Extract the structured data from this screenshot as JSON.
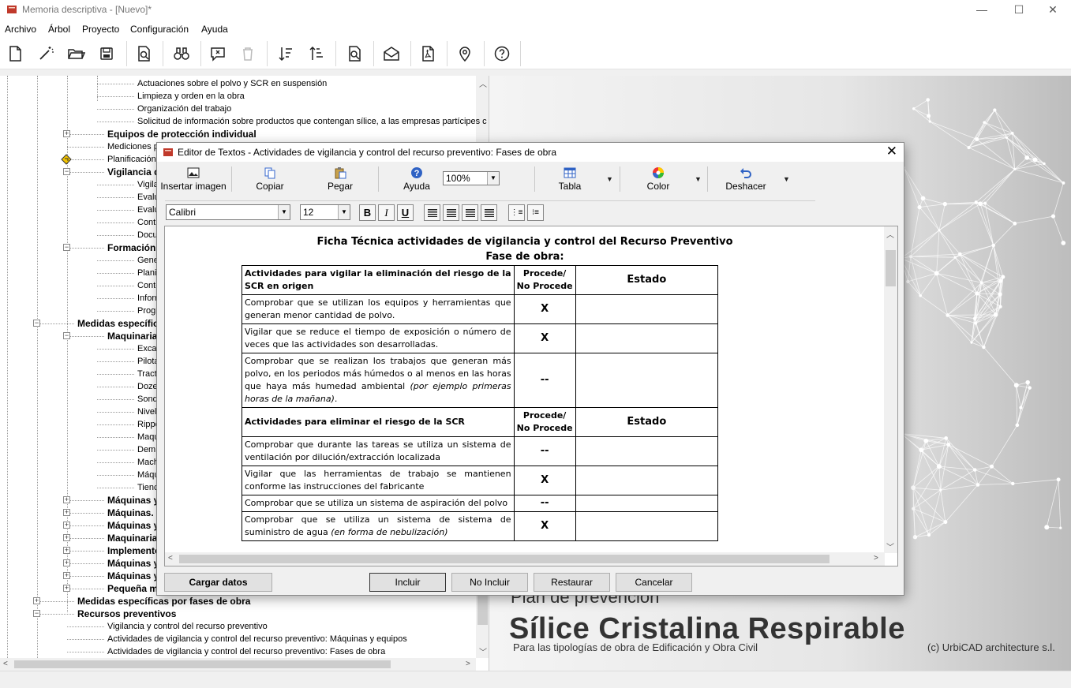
{
  "window": {
    "title": "Memoria descriptiva - [Nuevo]*",
    "minimize": "—",
    "maximize": "☐",
    "close": "✕"
  },
  "menu": [
    "Archivo",
    "Árbol",
    "Proyecto",
    "Configuración",
    "Ayuda"
  ],
  "tree": {
    "rows": [
      {
        "label": "Actuaciones sobre el polvo y SCR en suspensión",
        "bold": false
      },
      {
        "label": "Limpieza y orden en la obra",
        "bold": false
      },
      {
        "label": "Organización del trabajo",
        "bold": false
      },
      {
        "label": "Solicitud de información sobre productos que contengan sílice, a las empresas partícipes c",
        "bold": false
      },
      {
        "label": "Equipos de protección individual",
        "bold": true
      },
      {
        "label": "Mediciones p",
        "bold": false
      },
      {
        "label": "Planificación",
        "bold": false
      },
      {
        "label": "Vigilancia d",
        "bold": true
      },
      {
        "label": "Vigila",
        "bold": false
      },
      {
        "label": "Evalu",
        "bold": false
      },
      {
        "label": "Evalu",
        "bold": false
      },
      {
        "label": "Contr",
        "bold": false
      },
      {
        "label": "Docu",
        "bold": false
      },
      {
        "label": "Formación",
        "bold": true
      },
      {
        "label": "Gene",
        "bold": false
      },
      {
        "label": "Planif",
        "bold": false
      },
      {
        "label": "Conte",
        "bold": false
      },
      {
        "label": "Inforr",
        "bold": false
      },
      {
        "label": "Progr",
        "bold": false
      },
      {
        "label": "Medidas específic",
        "bold": true
      },
      {
        "label": "Maquinaria",
        "bold": true
      },
      {
        "label": "Exca",
        "bold": false
      },
      {
        "label": "Pilota",
        "bold": false
      },
      {
        "label": "Tract",
        "bold": false
      },
      {
        "label": "Doze",
        "bold": false
      },
      {
        "label": "Sond",
        "bold": false
      },
      {
        "label": "Nivel",
        "bold": false
      },
      {
        "label": "Rippe",
        "bold": false
      },
      {
        "label": "Maqu",
        "bold": false
      },
      {
        "label": "Dem",
        "bold": false
      },
      {
        "label": "Mach",
        "bold": false
      },
      {
        "label": "Máqu",
        "bold": false
      },
      {
        "label": "Tienc",
        "bold": false
      },
      {
        "label": "Máquinas y",
        "bold": true
      },
      {
        "label": "Máquinas.",
        "bold": true
      },
      {
        "label": "Máquinas y",
        "bold": true
      },
      {
        "label": "Maquinaria",
        "bold": true
      },
      {
        "label": "Implemento",
        "bold": true
      },
      {
        "label": "Máquinas y",
        "bold": true
      },
      {
        "label": "Máquinas y",
        "bold": true
      },
      {
        "label": "Pequeña m",
        "bold": true
      },
      {
        "label": "Medidas específicas por fases de obra",
        "bold": true
      },
      {
        "label": "Recursos preventivos",
        "bold": true
      },
      {
        "label": "Vigilancia y control del recurso preventivo",
        "bold": false
      },
      {
        "label": "Actividades de vigilancia y control del recurso preventivo: Máquinas y equipos",
        "bold": false
      },
      {
        "label": "Actividades de vigilancia y control del recurso preventivo: Fases de obra",
        "bold": false
      }
    ]
  },
  "background": {
    "subtitle": "Plan de prevención",
    "title": "Sílice Cristalina Respirable",
    "tagline": "Para las tipologías de obra de Edificación y Obra Civil",
    "copyright": "(c)  UrbiCAD architecture s.l."
  },
  "dialog": {
    "title": "Editor de Textos - Actividades de vigilancia y control del recurso preventivo: Fases de obra",
    "close": "✕",
    "toolbar": {
      "insert_image": "Insertar imagen",
      "copy": "Copiar",
      "paste": "Pegar",
      "help": "Ayuda",
      "zoom": "100%",
      "table": "Tabla",
      "color": "Color",
      "undo": "Deshacer"
    },
    "format": {
      "font": "Calibri",
      "size": "12",
      "bold": "B",
      "italic": "I",
      "underline": "U"
    },
    "document": {
      "title": "Ficha Técnica actividades de vigilancia y control del Recurso Preventivo",
      "subtitle": "Fase de obra:",
      "section1": {
        "header": "Actividades para vigilar la eliminación del riesgo de la SCR en origen",
        "col_procede": "Procede/ No Procede",
        "col_estado": "Estado",
        "rows": [
          {
            "text": "Comprobar que se utilizan los equipos y herramientas que generan menor cantidad de polvo.",
            "mark": "X"
          },
          {
            "text": "Vigilar que se reduce el tiempo de exposición o número de veces que las actividades son desarrolladas.",
            "mark": "X"
          },
          {
            "text": "Comprobar que se realizan los trabajos que generan más polvo, en los periodos más húmedos o al menos en las horas que haya más humedad ambiental ",
            "italic": "(por ejemplo primeras horas de la mañana)",
            "tail": ".",
            "mark": "--"
          }
        ]
      },
      "section2": {
        "header": "Actividades para eliminar el riesgo de la SCR",
        "col_procede": "Procede/ No Procede",
        "col_estado": "Estado",
        "rows": [
          {
            "text": "Comprobar que durante las tareas se utiliza un sistema de ventilación por dilución/extracción localizada",
            "mark": "--"
          },
          {
            "text": "Vigilar que las herramientas de trabajo se mantienen conforme las instrucciones del fabricante",
            "mark": "X"
          },
          {
            "text": "Comprobar que se utiliza un sistema de aspiración del polvo",
            "mark": "--"
          },
          {
            "text": "Comprobar que se utiliza un sistema de sistema de suministro de agua ",
            "italic": "(en forma de nebulización)",
            "mark": "X"
          }
        ]
      }
    },
    "buttons": {
      "load": "Cargar datos",
      "include": "Incluir",
      "exclude": "No Incluir",
      "restore": "Restaurar",
      "cancel": "Cancelar"
    }
  }
}
